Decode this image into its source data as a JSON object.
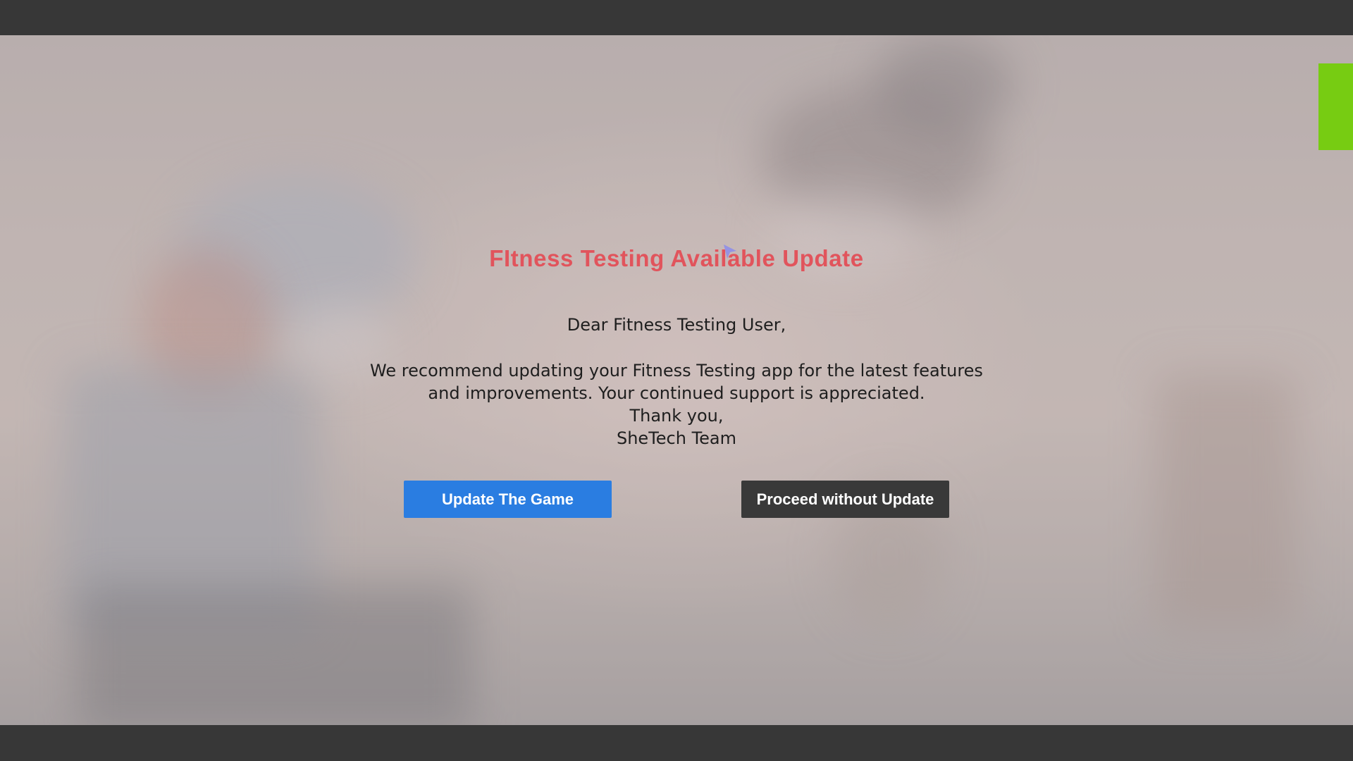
{
  "dialog": {
    "title": "FItness Testing Available Update",
    "greeting": "Dear Fitness Testing User,",
    "body_lines": [
      "We recommend updating your Fitness Testing app for the latest features",
      "and improvements. Your continued support is appreciated.",
      "Thank you,",
      "SheTech Team"
    ],
    "update_button": "Update The Game",
    "proceed_button": "Proceed without Update"
  },
  "colors": {
    "title": "#e1545c",
    "update_button": "#2a7de1",
    "proceed_button": "#393939",
    "side_tab": "#77cc12",
    "frame_bars": "#373737"
  },
  "icons": {
    "cursor": "cursor-pointer-icon"
  }
}
